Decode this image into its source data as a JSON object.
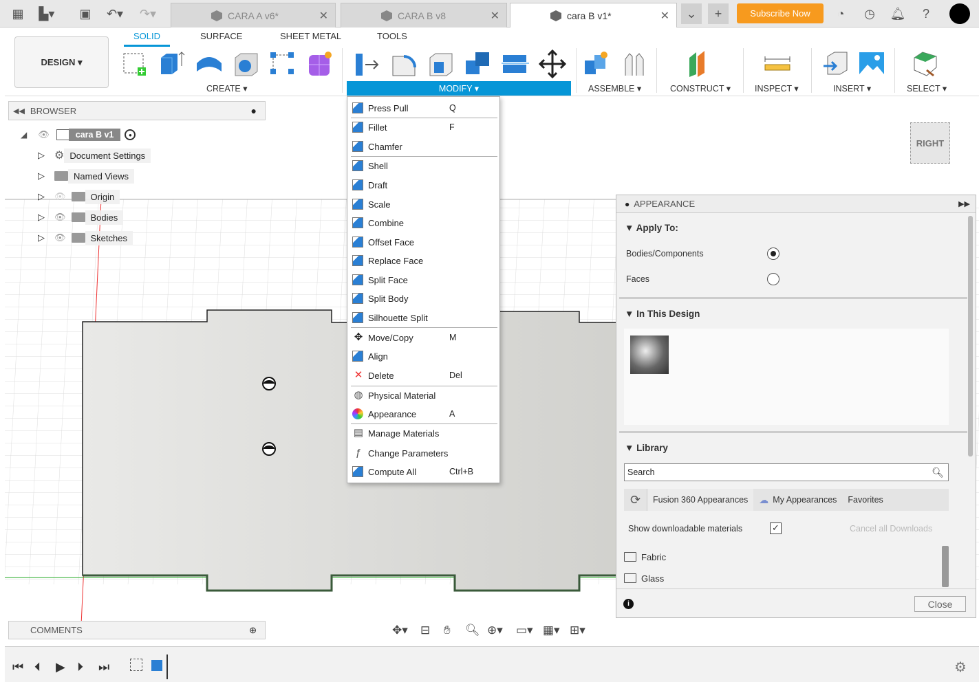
{
  "tabs": [
    {
      "label": "CARA A v6*",
      "active": false
    },
    {
      "label": "CARA B v8",
      "active": false
    },
    {
      "label": "cara B v1*",
      "active": true
    }
  ],
  "topbar": {
    "subscribe": "Subscribe Now"
  },
  "workspace": {
    "design": "DESIGN ▾",
    "tabs": [
      "SOLID",
      "SURFACE",
      "SHEET METAL",
      "TOOLS"
    ]
  },
  "groups": {
    "create": "CREATE ▾",
    "modify": "MODIFY ▾",
    "assemble": "ASSEMBLE ▾",
    "construct": "CONSTRUCT ▾",
    "inspect": "INSPECT ▾",
    "insert": "INSERT ▾",
    "select": "SELECT ▾"
  },
  "browser": {
    "title": "BROWSER",
    "root": "cara B v1",
    "items": [
      "Document Settings",
      "Named Views",
      "Origin",
      "Bodies",
      "Sketches"
    ]
  },
  "viewcube": {
    "face": "RIGHT"
  },
  "modify_menu": [
    {
      "label": "Press Pull",
      "key": "Q"
    },
    {
      "label": "Fillet",
      "key": "F"
    },
    {
      "label": "Chamfer",
      "key": ""
    },
    {
      "label": "Shell",
      "key": ""
    },
    {
      "label": "Draft",
      "key": ""
    },
    {
      "label": "Scale",
      "key": ""
    },
    {
      "label": "Combine",
      "key": ""
    },
    {
      "label": "Offset Face",
      "key": ""
    },
    {
      "label": "Replace Face",
      "key": ""
    },
    {
      "label": "Split Face",
      "key": ""
    },
    {
      "label": "Split Body",
      "key": ""
    },
    {
      "label": "Silhouette Split",
      "key": ""
    },
    {
      "label": "Move/Copy",
      "key": "M"
    },
    {
      "label": "Align",
      "key": ""
    },
    {
      "label": "Delete",
      "key": "Del"
    },
    {
      "label": "Physical Material",
      "key": ""
    },
    {
      "label": "Appearance",
      "key": "A"
    },
    {
      "label": "Manage Materials",
      "key": ""
    },
    {
      "label": "Change Parameters",
      "key": ""
    },
    {
      "label": "Compute All",
      "key": "Ctrl+B"
    }
  ],
  "appearance": {
    "title": "APPEARANCE",
    "apply_to": "Apply To:",
    "bodies": "Bodies/Components",
    "faces": "Faces",
    "in_design": "In This Design",
    "library": "Library",
    "search_placeholder": "Search",
    "lib_tabs": [
      "Fusion 360 Appearances",
      "My Appearances",
      "Favorites"
    ],
    "show_dl": "Show downloadable materials",
    "cancel_dl": "Cancel all Downloads",
    "folders": [
      "Fabric",
      "Glass"
    ],
    "close": "Close"
  },
  "comments": {
    "title": "COMMENTS"
  }
}
